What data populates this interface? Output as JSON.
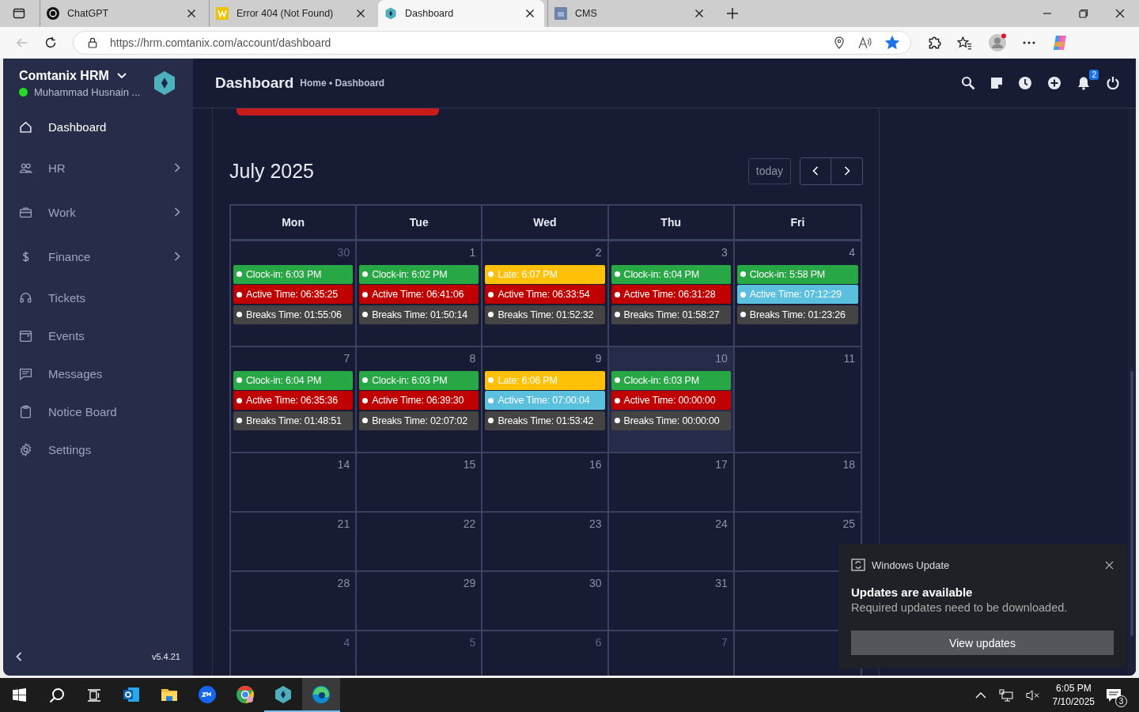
{
  "browser": {
    "tabs": [
      {
        "kind": "chatgpt",
        "title": "ChatGPT",
        "selected": false
      },
      {
        "kind": "w",
        "title": "Error 404 (Not Found)",
        "selected": false
      },
      {
        "kind": "hex",
        "title": "Dashboard",
        "selected": true
      },
      {
        "kind": "cms",
        "title": "CMS",
        "selected": false
      }
    ],
    "url": "https://hrm.comtanix.com/account/dashboard",
    "favorite": true
  },
  "app": {
    "brand": "Comtanix HRM",
    "user": "Muhammad Husnain ...",
    "online": true,
    "sidebar": {
      "items": [
        {
          "kind": "home",
          "label": "Dashboard",
          "selected": true,
          "submenu": false
        },
        {
          "kind": "people",
          "label": "HR",
          "selected": false,
          "submenu": true
        },
        {
          "kind": "briefcase",
          "label": "Work",
          "selected": false,
          "submenu": true
        },
        {
          "kind": "dollar",
          "label": "Finance",
          "selected": false,
          "submenu": true
        },
        {
          "kind": "headset",
          "label": "Tickets",
          "selected": false,
          "submenu": false
        },
        {
          "kind": "calendar",
          "label": "Events",
          "selected": false,
          "submenu": false
        },
        {
          "kind": "chat",
          "label": "Messages",
          "selected": false,
          "submenu": false
        },
        {
          "kind": "clipboard",
          "label": "Notice Board",
          "selected": false,
          "submenu": false
        },
        {
          "kind": "gear",
          "label": "Settings",
          "selected": false,
          "submenu": false
        }
      ],
      "version": "v5.4.21"
    },
    "header": {
      "title": "Dashboard",
      "breadcrumb": "Home • Dashboard",
      "notifications": "2"
    },
    "calendar": {
      "title": "July 2025",
      "today_button": "today",
      "weekdays": [
        "Mon",
        "Tue",
        "Wed",
        "Thu",
        "Fri"
      ],
      "weeks": [
        [
          {
            "day": "30",
            "other_month": true,
            "today": false,
            "events": [
              {
                "text": "Clock-in: 6:03 PM",
                "color": "#28a745"
              },
              {
                "text": "Active Time: 06:35:25",
                "color": "#c00000"
              },
              {
                "text": "Breaks Time: 01:55:06",
                "color": "#444444"
              }
            ]
          },
          {
            "day": "1",
            "other_month": false,
            "today": false,
            "events": [
              {
                "text": "Clock-in: 6:02 PM",
                "color": "#28a745"
              },
              {
                "text": "Active Time: 06:41:06",
                "color": "#c00000"
              },
              {
                "text": "Breaks Time: 01:50:14",
                "color": "#444444"
              }
            ]
          },
          {
            "day": "2",
            "other_month": false,
            "today": false,
            "events": [
              {
                "text": "Late: 6:07 PM",
                "color": "#ffc107"
              },
              {
                "text": "Active Time: 06:33:54",
                "color": "#c00000"
              },
              {
                "text": "Breaks Time: 01:52:32",
                "color": "#444444"
              }
            ]
          },
          {
            "day": "3",
            "other_month": false,
            "today": false,
            "events": [
              {
                "text": "Clock-in: 6:04 PM",
                "color": "#28a745"
              },
              {
                "text": "Active Time: 06:31:28",
                "color": "#c00000"
              },
              {
                "text": "Breaks Time: 01:58:27",
                "color": "#444444"
              }
            ]
          },
          {
            "day": "4",
            "other_month": false,
            "today": false,
            "events": [
              {
                "text": "Clock-in: 5:58 PM",
                "color": "#28a745"
              },
              {
                "text": "Active Time: 07:12:29",
                "color": "#5bc0de"
              },
              {
                "text": "Breaks Time: 01:23:26",
                "color": "#444444"
              }
            ]
          }
        ],
        [
          {
            "day": "7",
            "other_month": false,
            "today": false,
            "events": [
              {
                "text": "Clock-in: 6:04 PM",
                "color": "#28a745"
              },
              {
                "text": "Active Time: 06:35:36",
                "color": "#c00000"
              },
              {
                "text": "Breaks Time: 01:48:51",
                "color": "#444444"
              }
            ]
          },
          {
            "day": "8",
            "other_month": false,
            "today": false,
            "events": [
              {
                "text": "Clock-in: 6:03 PM",
                "color": "#28a745"
              },
              {
                "text": "Active Time: 06:39:30",
                "color": "#c00000"
              },
              {
                "text": "Breaks Time: 02:07:02",
                "color": "#444444"
              }
            ]
          },
          {
            "day": "9",
            "other_month": false,
            "today": false,
            "events": [
              {
                "text": "Late: 6:06 PM",
                "color": "#ffc107"
              },
              {
                "text": "Active Time: 07:00:04",
                "color": "#5bc0de"
              },
              {
                "text": "Breaks Time: 01:53:42",
                "color": "#444444"
              }
            ]
          },
          {
            "day": "10",
            "other_month": false,
            "today": true,
            "events": [
              {
                "text": "Clock-in: 6:03 PM",
                "color": "#28a745"
              },
              {
                "text": "Active Time: 00:00:00",
                "color": "#c00000"
              },
              {
                "text": "Breaks Time: 00:00:00",
                "color": "#444444"
              }
            ]
          },
          {
            "day": "11",
            "other_month": false,
            "today": false
          }
        ],
        [
          {
            "day": "14",
            "other_month": false,
            "today": false
          },
          {
            "day": "15",
            "other_month": false,
            "today": false
          },
          {
            "day": "16",
            "other_month": false,
            "today": false
          },
          {
            "day": "17",
            "other_month": false,
            "today": false
          },
          {
            "day": "18",
            "other_month": false,
            "today": false
          }
        ],
        [
          {
            "day": "21",
            "other_month": false,
            "today": false
          },
          {
            "day": "22",
            "other_month": false,
            "today": false
          },
          {
            "day": "23",
            "other_month": false,
            "today": false
          },
          {
            "day": "24",
            "other_month": false,
            "today": false
          },
          {
            "day": "25",
            "other_month": false,
            "today": false
          }
        ],
        [
          {
            "day": "28",
            "other_month": false,
            "today": false
          },
          {
            "day": "29",
            "other_month": false,
            "today": false
          },
          {
            "day": "30",
            "other_month": false,
            "today": false
          },
          {
            "day": "31",
            "other_month": false,
            "today": false
          },
          {
            "today": false
          }
        ],
        [
          {
            "day": "4",
            "other_month": true,
            "today": false
          },
          {
            "day": "5",
            "other_month": true,
            "today": false
          },
          {
            "day": "6",
            "other_month": true,
            "today": false
          },
          {
            "day": "7",
            "other_month": true,
            "today": false
          },
          {
            "today": false
          }
        ]
      ]
    }
  },
  "toast": {
    "app": "Windows Update",
    "title": "Updates are available",
    "message": "Required updates need to be downloaded.",
    "button": "View updates"
  },
  "taskbar": {
    "apps": [
      {
        "kind": "outlook",
        "selected": false,
        "running": false
      },
      {
        "kind": "folder",
        "selected": false,
        "running": false
      },
      {
        "kind": "zoom",
        "selected": false,
        "running": false
      },
      {
        "kind": "chrome",
        "selected": false,
        "running": false
      },
      {
        "kind": "hex",
        "selected": false,
        "running": true
      },
      {
        "kind": "edge",
        "selected": true,
        "running": true
      }
    ],
    "time": "6:05 PM",
    "date": "7/10/2025",
    "notifications": "3"
  }
}
